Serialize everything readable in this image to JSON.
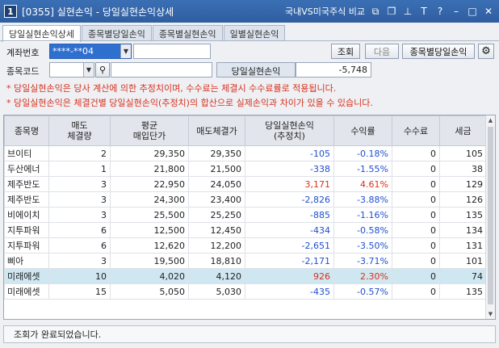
{
  "window": {
    "number": "1",
    "title": "[0355] 실현손익 - 당일실현손익상세",
    "right_text": "국내VS미국주식 비교",
    "icons": [
      "link-icon",
      "copy-icon",
      "pin-icon",
      "tag-icon",
      "help-icon",
      "minimize-icon",
      "maximize-icon",
      "close-icon"
    ]
  },
  "tabs": [
    {
      "label": "당일실현손익상세",
      "active": true
    },
    {
      "label": "종목별당일손익",
      "active": false
    },
    {
      "label": "종목별실현손익",
      "active": false
    },
    {
      "label": "일별실현손익",
      "active": false
    }
  ],
  "form": {
    "account_label": "계좌번호",
    "account_value": "****-**04",
    "stock_label": "종목코드",
    "query_button": "조회",
    "next_button": "다음",
    "by_stock_button": "종목별당일손익",
    "profit_label": "당일실현손익",
    "profit_value": "-5,748"
  },
  "notes": [
    "* 당일실현손익은 당사 계산에 의한 추정치이며, 수수료는 체결시 수수료률로 적용됩니다.",
    "* 당일실현손익은 체결건별 당일실현손익(추정치)의 합산으로 실제손익과 차이가 있을 수 있습니다."
  ],
  "table": {
    "headers": [
      [
        "종목명",
        ""
      ],
      [
        "매도",
        "체결량"
      ],
      [
        "평균",
        "매입단가"
      ],
      [
        "매도체결가",
        ""
      ],
      [
        "당일실현손익",
        "(추정치)"
      ],
      [
        "수익률",
        ""
      ],
      [
        "수수료",
        ""
      ],
      [
        "세금",
        ""
      ]
    ],
    "rows": [
      {
        "name": "브이티",
        "qty": "2",
        "avg": "29,350",
        "sell": "29,350",
        "pnl": "-105",
        "rate": "-0.18%",
        "fee": "0",
        "tax": "105",
        "sign": "neg",
        "hl": false
      },
      {
        "name": "두산에너",
        "qty": "1",
        "avg": "21,800",
        "sell": "21,500",
        "pnl": "-338",
        "rate": "-1.55%",
        "fee": "0",
        "tax": "38",
        "sign": "neg",
        "hl": false
      },
      {
        "name": "제주반도",
        "qty": "3",
        "avg": "22,950",
        "sell": "24,050",
        "pnl": "3,171",
        "rate": "4.61%",
        "fee": "0",
        "tax": "129",
        "sign": "pos",
        "hl": false
      },
      {
        "name": "제주반도",
        "qty": "3",
        "avg": "24,300",
        "sell": "23,400",
        "pnl": "-2,826",
        "rate": "-3.88%",
        "fee": "0",
        "tax": "126",
        "sign": "neg",
        "hl": false
      },
      {
        "name": "비에이치",
        "qty": "3",
        "avg": "25,500",
        "sell": "25,250",
        "pnl": "-885",
        "rate": "-1.16%",
        "fee": "0",
        "tax": "135",
        "sign": "neg",
        "hl": false
      },
      {
        "name": "지투파워",
        "qty": "6",
        "avg": "12,500",
        "sell": "12,450",
        "pnl": "-434",
        "rate": "-0.58%",
        "fee": "0",
        "tax": "134",
        "sign": "neg",
        "hl": false
      },
      {
        "name": "지투파워",
        "qty": "6",
        "avg": "12,620",
        "sell": "12,200",
        "pnl": "-2,651",
        "rate": "-3.50%",
        "fee": "0",
        "tax": "131",
        "sign": "neg",
        "hl": false
      },
      {
        "name": "삐아",
        "qty": "3",
        "avg": "19,500",
        "sell": "18,810",
        "pnl": "-2,171",
        "rate": "-3.71%",
        "fee": "0",
        "tax": "101",
        "sign": "neg",
        "hl": false
      },
      {
        "name": "미래에셋",
        "qty": "10",
        "avg": "4,020",
        "sell": "4,120",
        "pnl": "926",
        "rate": "2.30%",
        "fee": "0",
        "tax": "74",
        "sign": "pos",
        "hl": true
      },
      {
        "name": "미래에셋",
        "qty": "15",
        "avg": "5,050",
        "sell": "5,030",
        "pnl": "-435",
        "rate": "-0.57%",
        "fee": "0",
        "tax": "135",
        "sign": "neg",
        "hl": false
      }
    ]
  },
  "status": "조회가 완료되었습니다."
}
